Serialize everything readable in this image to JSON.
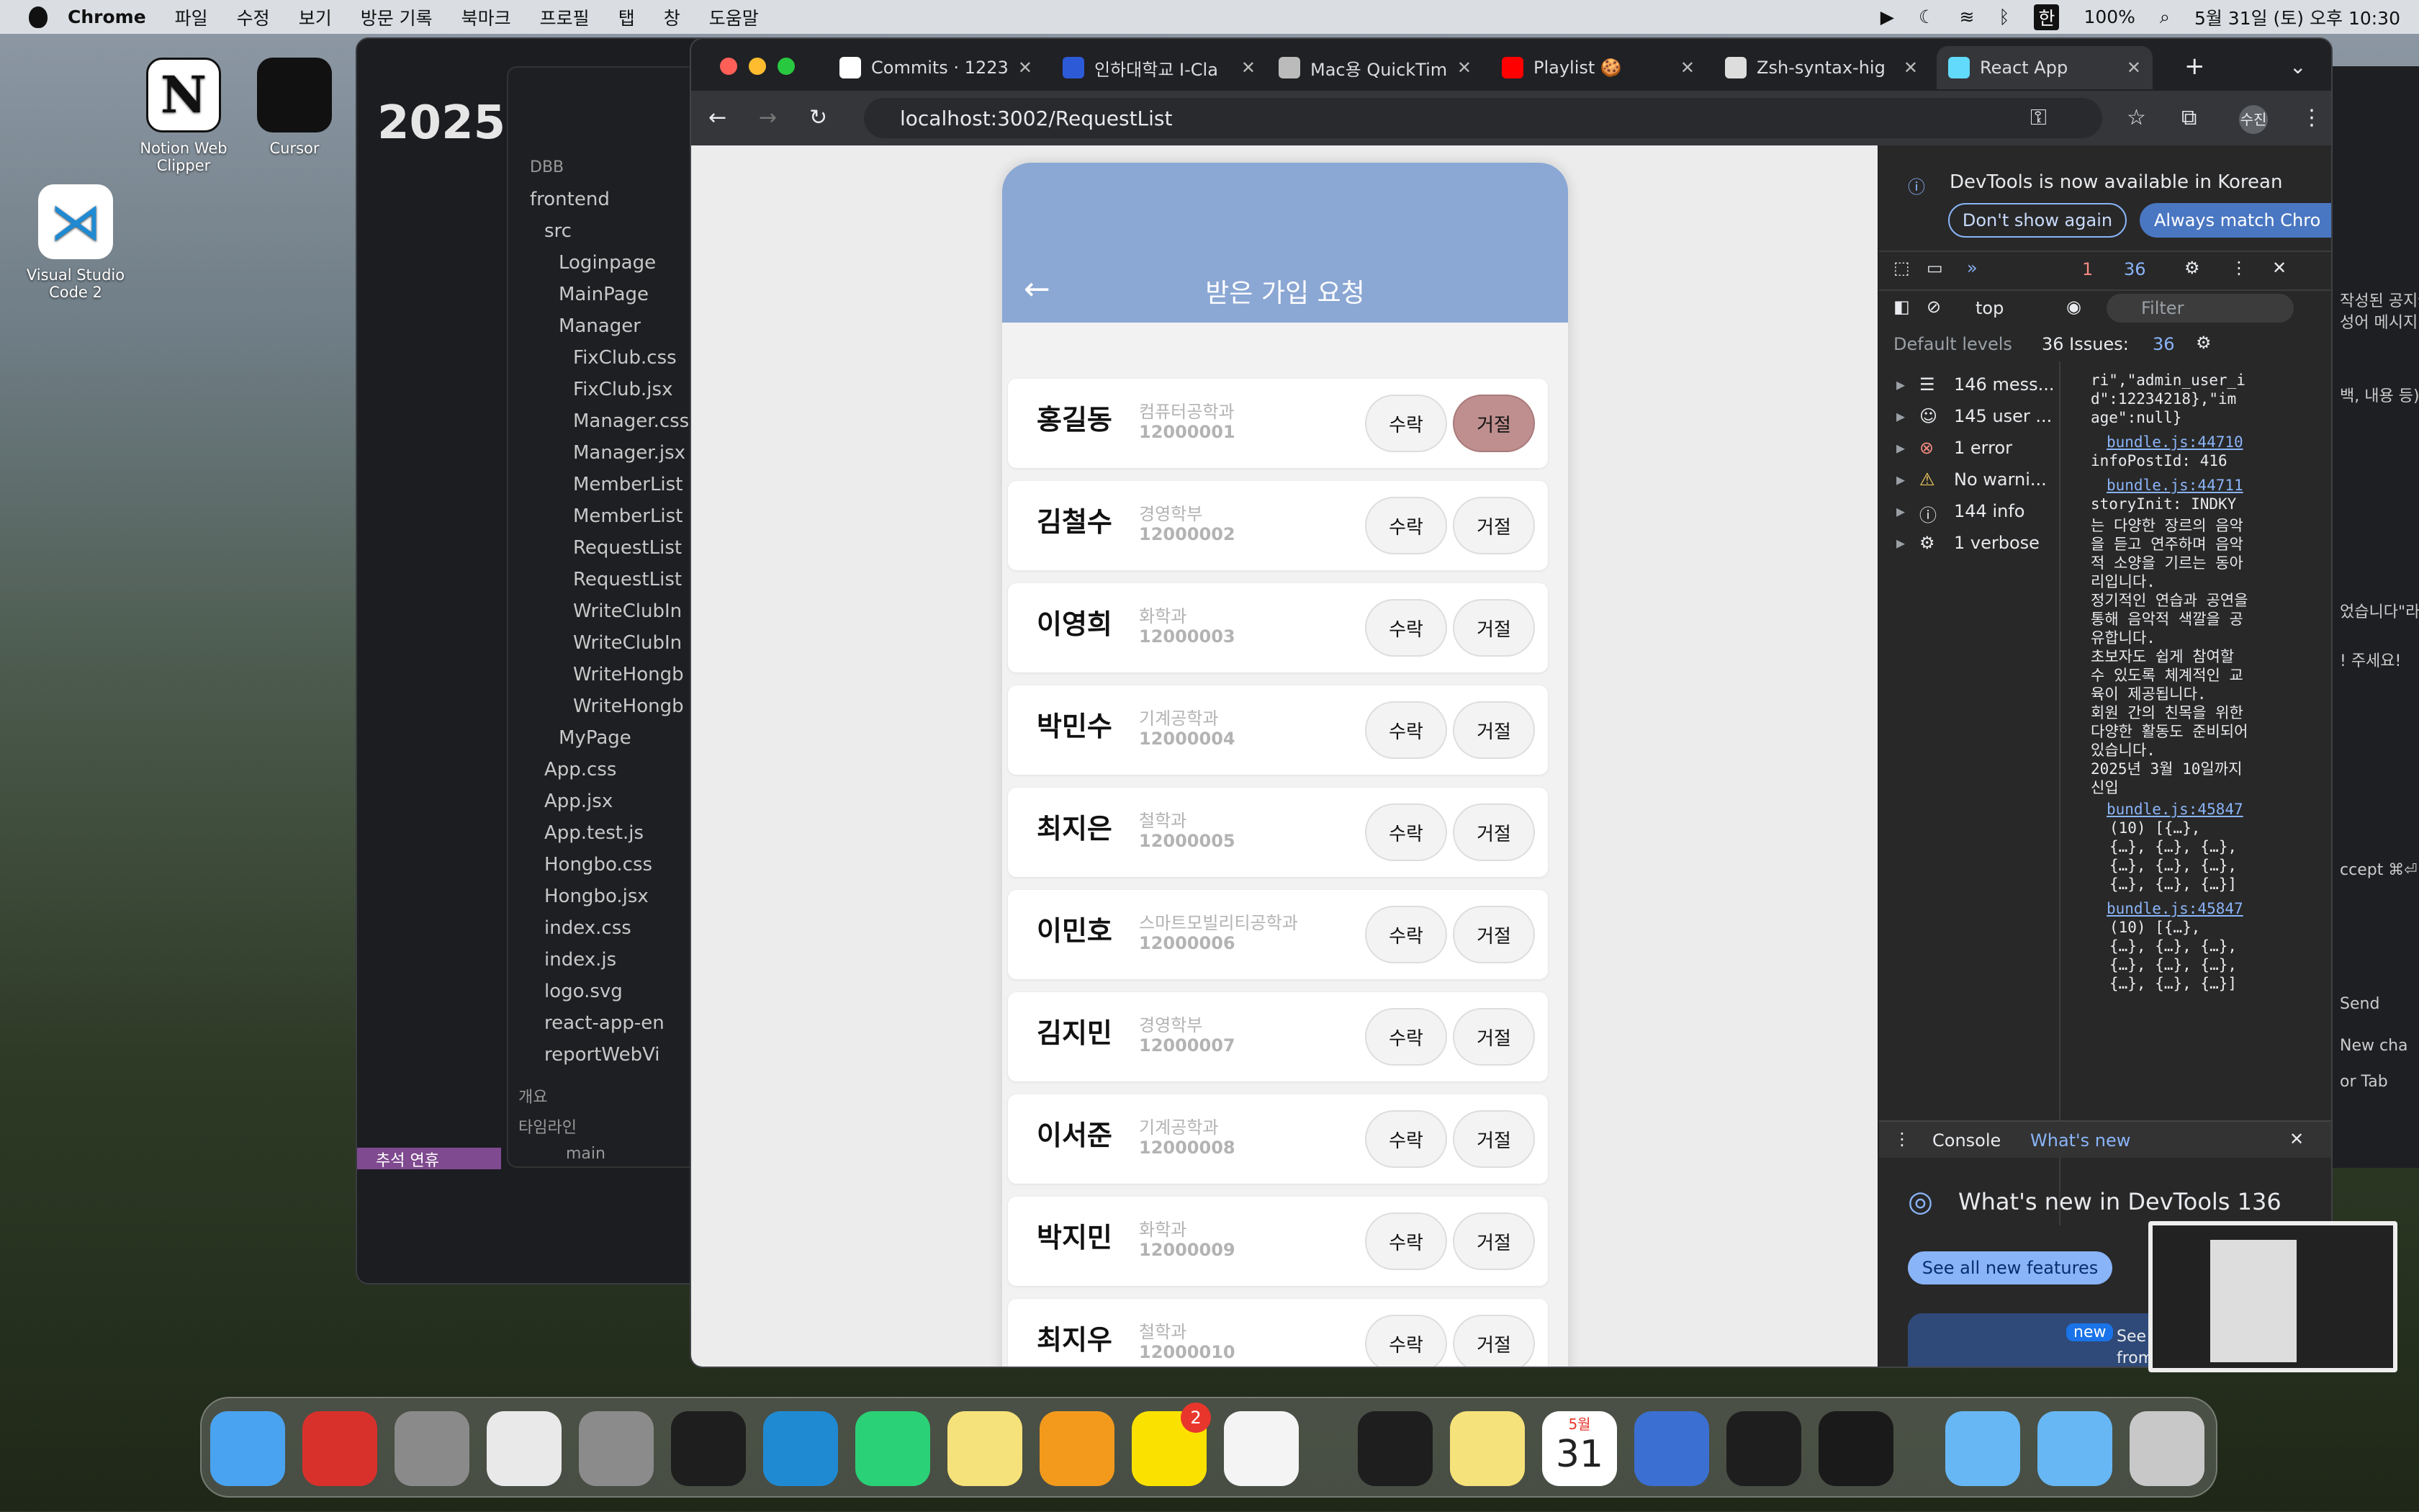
{
  "menubar": {
    "app_name": "Chrome",
    "menus": [
      "파일",
      "수정",
      "보기",
      "방문 기록",
      "북마크",
      "프로필",
      "탭",
      "창",
      "도움말"
    ],
    "battery": "100%",
    "clock": "5월 31일 (토) 오후 10:30",
    "input_method": "한"
  },
  "desktop": {
    "icons": [
      {
        "label": "Notion Web Clipper"
      },
      {
        "label": "Cursor"
      },
      {
        "label": "Visual Studio Code 2"
      }
    ]
  },
  "background_windows": {
    "notion_heading": "2025",
    "notion_bottom_label": "추석 연휴",
    "explorer": {
      "root": "DBB",
      "items": [
        "frontend",
        "src",
        "Loginpage",
        "MainPage",
        "Manager",
        "FixClub.css",
        "FixClub.jsx",
        "Manager.css",
        "Manager.jsx",
        "MemberList",
        "MemberList",
        "RequestList",
        "RequestList",
        "WriteClubIn",
        "WriteClubIn",
        "WriteHongb",
        "WriteHongb",
        "MyPage",
        "App.css",
        "App.jsx",
        "App.test.js",
        "Hongbo.css",
        "Hongbo.jsx",
        "index.css",
        "index.js",
        "logo.svg",
        "react-app-en",
        "reportWebVi"
      ],
      "outline_label": "개요",
      "timeline_label": "타임라인",
      "branch": "main"
    }
  },
  "browser": {
    "tabs": [
      {
        "title": "Commits · 1223",
        "color": "#ffffff"
      },
      {
        "title": "인하대학교 I-Cla",
        "color": "#2d5bd8"
      },
      {
        "title": "Mac용 QuickTim",
        "color": "#bbbbbb"
      },
      {
        "title": "Playlist 🍪",
        "color": "#ff0000"
      },
      {
        "title": "Zsh-syntax-hig",
        "color": "#dddddd"
      },
      {
        "title": "React App",
        "color": "#61dafb",
        "active": true
      }
    ],
    "url": "localhost:3002/RequestList",
    "profile_label": "수진"
  },
  "page": {
    "title": "받은 가입 요청",
    "accept_label": "수락",
    "reject_label": "거절",
    "requests": [
      {
        "name": "홍길동",
        "department": "컴퓨터공학과",
        "student_id": "12000001",
        "reject_pressed": true
      },
      {
        "name": "김철수",
        "department": "경영학부",
        "student_id": "12000002"
      },
      {
        "name": "이영희",
        "department": "화학과",
        "student_id": "12000003"
      },
      {
        "name": "박민수",
        "department": "기계공학과",
        "student_id": "12000004"
      },
      {
        "name": "최지은",
        "department": "철학과",
        "student_id": "12000005"
      },
      {
        "name": "이민호",
        "department": "스마트모빌리티공학과",
        "student_id": "12000006"
      },
      {
        "name": "김지민",
        "department": "경영학부",
        "student_id": "12000007"
      },
      {
        "name": "이서준",
        "department": "기계공학과",
        "student_id": "12000008"
      },
      {
        "name": "박지민",
        "department": "화학과",
        "student_id": "12000009"
      },
      {
        "name": "최지우",
        "department": "철학과",
        "student_id": "12000010"
      }
    ],
    "colors": {
      "header": "#8ba7d4",
      "reject_active": "#bf8f8f"
    }
  },
  "devtools": {
    "banner_text": "DevTools is now available in Korean",
    "dont_show": "Don't show again",
    "always_match": "Always match Chro",
    "error_count": "1",
    "issue_count": "36",
    "context": "top",
    "filter_placeholder": "Filter",
    "levels": "Default levels",
    "issues_label": "36 Issues:",
    "issues_badge": "36",
    "sidebar": [
      {
        "label": "146 mess...",
        "icon": "list-icon"
      },
      {
        "label": "145 user ...",
        "icon": "user-icon"
      },
      {
        "label": "1 error",
        "icon": "error-icon"
      },
      {
        "label": "No warni...",
        "icon": "warning-icon"
      },
      {
        "label": "144 info",
        "icon": "info-icon"
      },
      {
        "label": "1 verbose",
        "icon": "bug-icon"
      }
    ],
    "log_lines": [
      "ri\",\"admin_user_i",
      "d\":12234218},\"im",
      "age\":null}",
      "bundle.js:44710",
      "infoPostId: 416",
      "bundle.js:44711",
      "storyInit: INDKY",
      "는 다양한 장르의 음악",
      "을 듣고 연주하며 음악",
      "적 소양을 기르는 동아",
      "리입니다.",
      "정기적인 연습과 공연을",
      "통해 음악적 색깔을 공",
      "유합니다.",
      "초보자도 쉽게 참여할",
      "수 있도록 체계적인 교",
      "육이 제공됩니다.",
      "회원 간의 친목을 위한",
      "다양한 활동도 준비되어",
      "있습니다.",
      "2025년 3월 10일까지",
      "신입",
      "bundle.js:45847",
      "(10) [{…},",
      "{…}, {…}, {…},",
      "{…}, {…}, {…},",
      "{…}, {…}, {…}]",
      "bundle.js:45847",
      "(10) [{…},",
      "{…}, {…}, {…},",
      "{…}, {…}, {…},",
      "{…}, {…}, {…}]"
    ],
    "drawer_tabs": [
      "Console",
      "What's new"
    ],
    "whats_new_title": "What's new in DevTools 136",
    "see_features": "See all new features",
    "new_badge": "new",
    "see_text": "See t",
    "from_text": "from"
  },
  "right_strip": {
    "lines": [
      "작성된 공지글",
      "성어 메시지",
      "백, 내용 등)",
      "었습니다\"라",
      "! 주세요!",
      "ccept ⌘⏎",
      "Send",
      "New cha",
      "or Tab"
    ]
  },
  "dock": {
    "badge_count": "2",
    "calendar_month": "5월",
    "calendar_day": "31",
    "apps": [
      "finder",
      "photo-booth",
      "launchpad",
      "chrome",
      "system-settings",
      "terminal",
      "vscode",
      "clion",
      "notes",
      "pages",
      "kakaotalk",
      "textedit",
      "figma",
      "stickies",
      "calendar",
      "quicktime",
      "terminal-2",
      "cursor",
      "applications-folder",
      "downloads-folder",
      "trash"
    ]
  }
}
